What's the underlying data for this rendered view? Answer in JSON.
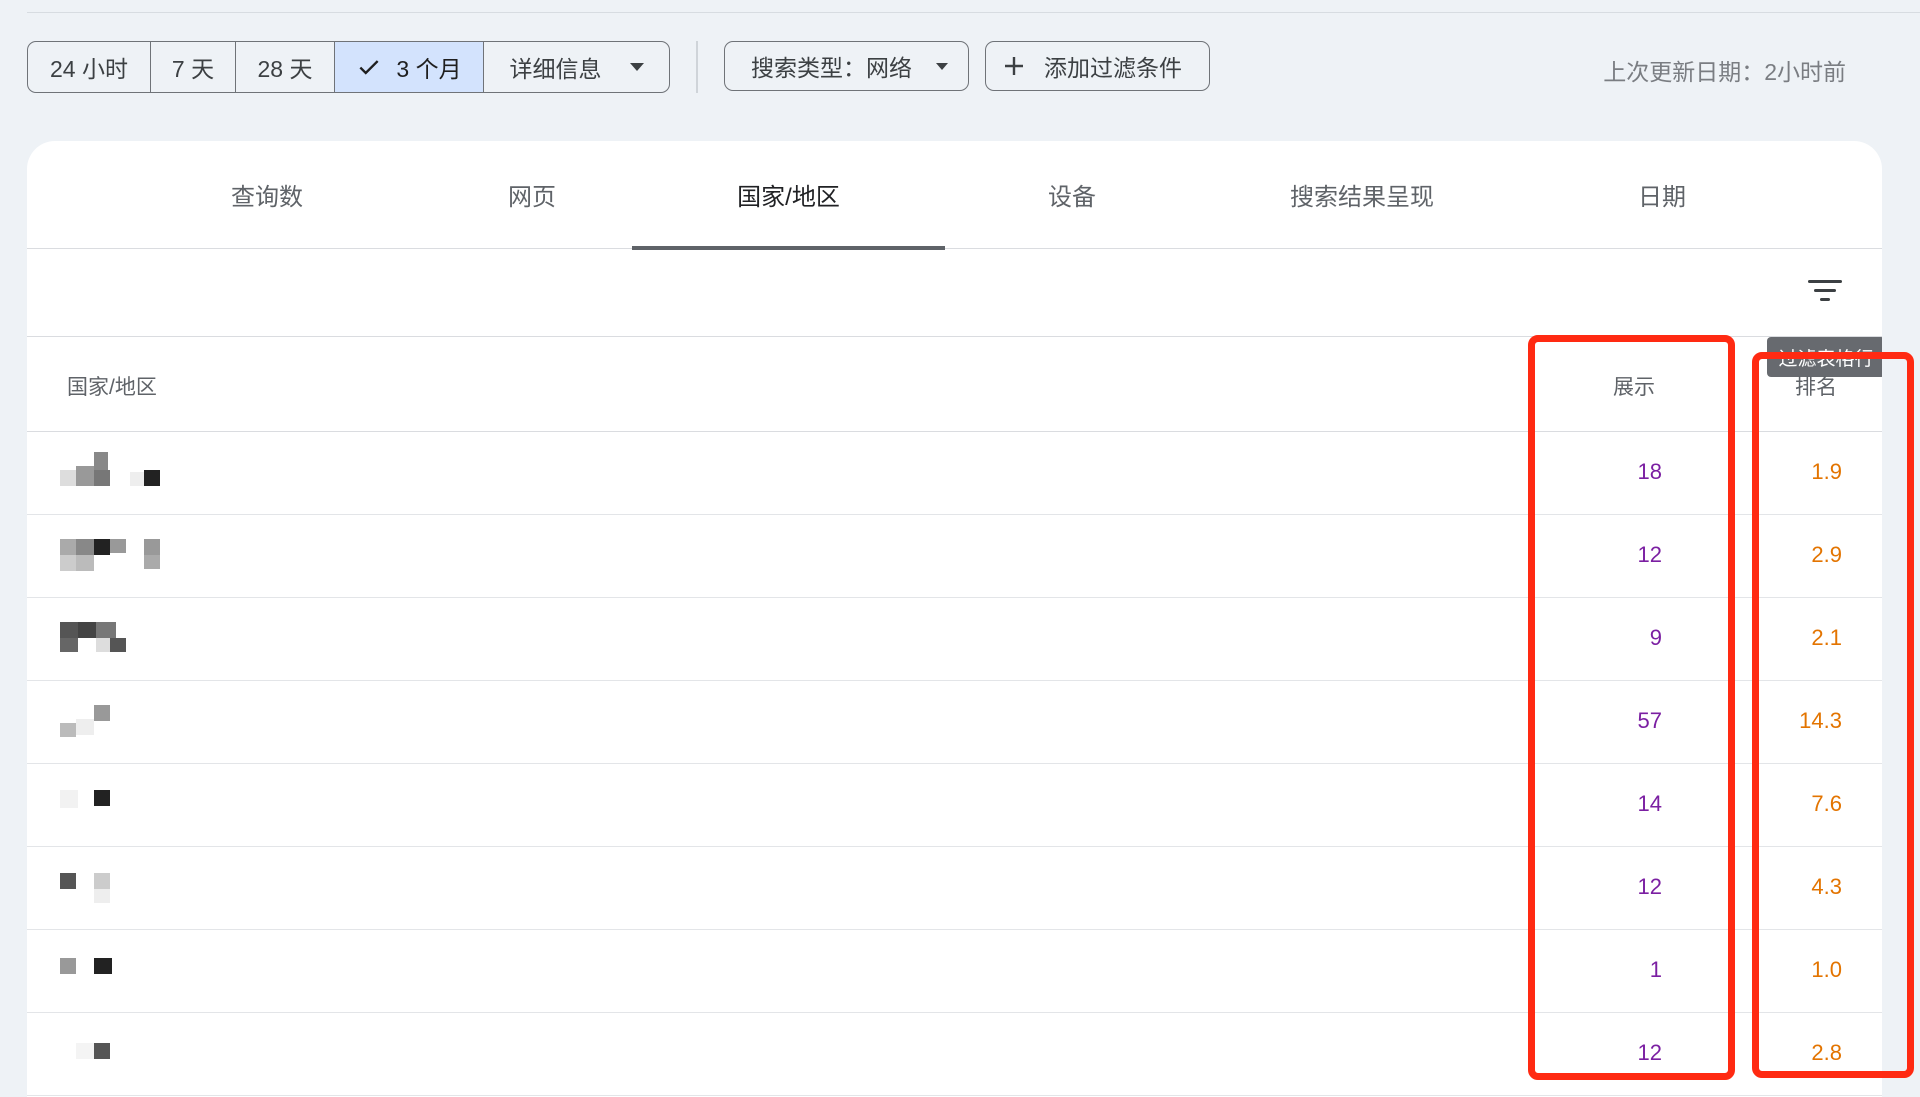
{
  "toolbar": {
    "ranges": [
      {
        "label": "24 小时",
        "active": false
      },
      {
        "label": "7 天",
        "active": false
      },
      {
        "label": "28 天",
        "active": false
      },
      {
        "label": "3 个月",
        "active": true
      },
      {
        "label": "详细信息",
        "active": false
      }
    ],
    "search_type": "搜索类型：网络",
    "add_filter": "添加过滤条件",
    "last_updated": "上次更新日期：2小时前"
  },
  "tabs": [
    {
      "label": "查询数",
      "active": false
    },
    {
      "label": "网页",
      "active": false
    },
    {
      "label": "国家/地区",
      "active": true
    },
    {
      "label": "设备",
      "active": false
    },
    {
      "label": "搜索结果呈现",
      "active": false
    },
    {
      "label": "日期",
      "active": false
    }
  ],
  "table": {
    "headers": {
      "country": "国家/地区",
      "impressions": "展示",
      "position": "排名"
    },
    "tooltip": "过滤表格行",
    "rows": [
      {
        "impressions": "18",
        "position": "1.9"
      },
      {
        "impressions": "12",
        "position": "2.9"
      },
      {
        "impressions": "9",
        "position": "2.1"
      },
      {
        "impressions": "57",
        "position": "14.3"
      },
      {
        "impressions": "14",
        "position": "7.6"
      },
      {
        "impressions": "12",
        "position": "4.3"
      },
      {
        "impressions": "1",
        "position": "1.0"
      },
      {
        "impressions": "12",
        "position": "2.8"
      }
    ]
  },
  "colors": {
    "impressions": "#7b1fa2",
    "position": "#e37400",
    "active_range": "#d3e3fd",
    "annotation": "#ff2a12"
  },
  "icons": [
    "check-icon",
    "dropdown-caret-icon",
    "plus-icon",
    "filter-icon"
  ]
}
